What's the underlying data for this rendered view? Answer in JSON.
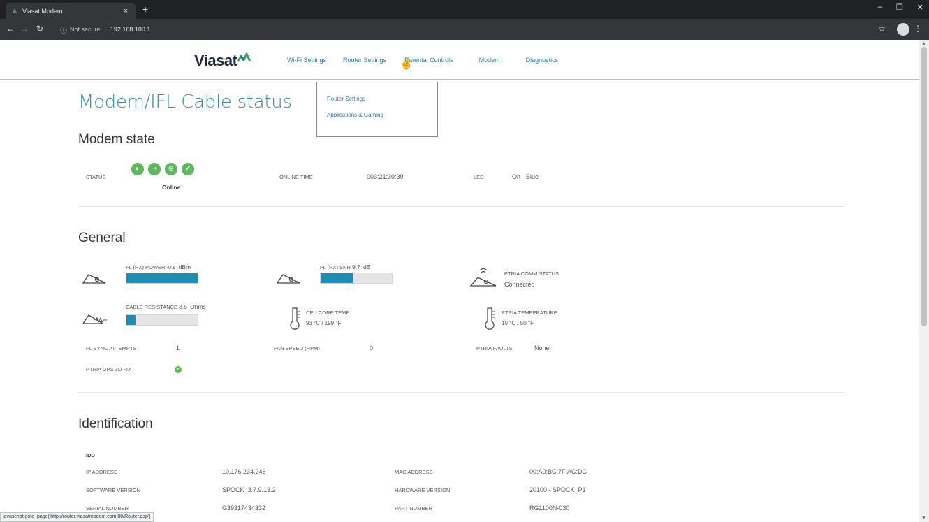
{
  "browser": {
    "tab_title": "Viasat Modem",
    "tab_close": "×",
    "new_tab": "+",
    "security_label": "Not secure",
    "url": "192.168.100.1",
    "status_url": "javascript:goto_page('http://router.viasatmodem.com:80/Router.asp')"
  },
  "header": {
    "logo_text": "Viasat",
    "nav": [
      "Wi-Fi Settings",
      "Router Settings",
      "Parental Controls",
      "Modem",
      "Diagnostics"
    ],
    "dropdown": [
      "Router Settings",
      "Applications & Gaming"
    ]
  },
  "page_title": "Modem/IFL Cable status",
  "modem_state": {
    "heading": "Modem state",
    "status_label": "STATUS",
    "status_value": "Online",
    "online_time_label": "ONLINE TIME",
    "online_time_value": "003:21:30:39",
    "led_label": "LED",
    "led_value": "On - Blue"
  },
  "general": {
    "heading": "General",
    "fl_power_label": "FL (RX) POWER",
    "fl_power_value": "-0.8",
    "fl_power_unit": "dBm",
    "fl_power_fill": 1.0,
    "fl_snr_label": "FL (RX) SNR",
    "fl_snr_value": "9.7",
    "fl_snr_unit": "dB",
    "fl_snr_fill": 0.45,
    "ptria_comm_label": "PTRIA COMM STATUS",
    "ptria_comm_value": "Connected",
    "cable_res_label": "CABLE RESISTANCE",
    "cable_res_value": "3.5",
    "cable_res_unit": "Ohms",
    "cable_res_fill": 0.13,
    "cpu_temp_label": "CPU CORE TEMP",
    "cpu_temp_value": "93 °C / 199 °F",
    "ptria_temp_label": "PTRIA TEMPERATURE",
    "ptria_temp_value": "10 °C / 50 °F",
    "fl_sync_label": "FL SYNC ATTEMPTS",
    "fl_sync_value": "1",
    "fan_label": "FAN SPEED (RPM)",
    "fan_value": "0",
    "ptria_faults_label": "PTRIA FAULTS",
    "ptria_faults_value": "None",
    "gps_label": "PTRIA GPS 3D FIX",
    "gps_ok": true
  },
  "identification": {
    "heading": "Identification",
    "idu_label": "IDU",
    "ip_label": "IP ADDRESS",
    "ip_value": "10.176.234.246",
    "mac_label": "MAC ADDRESS",
    "mac_value": "00:A0:BC:7F:AC:DC",
    "sw_label": "SOFTWARE VERSION",
    "sw_value": "SPOCK_3.7.9.13.2",
    "hw_label": "HARDWARE VERSION",
    "hw_value": "20100 - SPOCK_P1",
    "serial_label": "SERIAL NUMBER",
    "serial_value": "G39317434332",
    "part_label": "PART NUMBER",
    "part_value": "RG1100N-030"
  },
  "colors": {
    "accent": "#1f8cb3",
    "link": "#2f7ea3",
    "status_green": "#5cb85c"
  },
  "icons": {
    "status": [
      "signal-icon",
      "transmit-icon",
      "network-icon",
      "check-icon"
    ]
  }
}
